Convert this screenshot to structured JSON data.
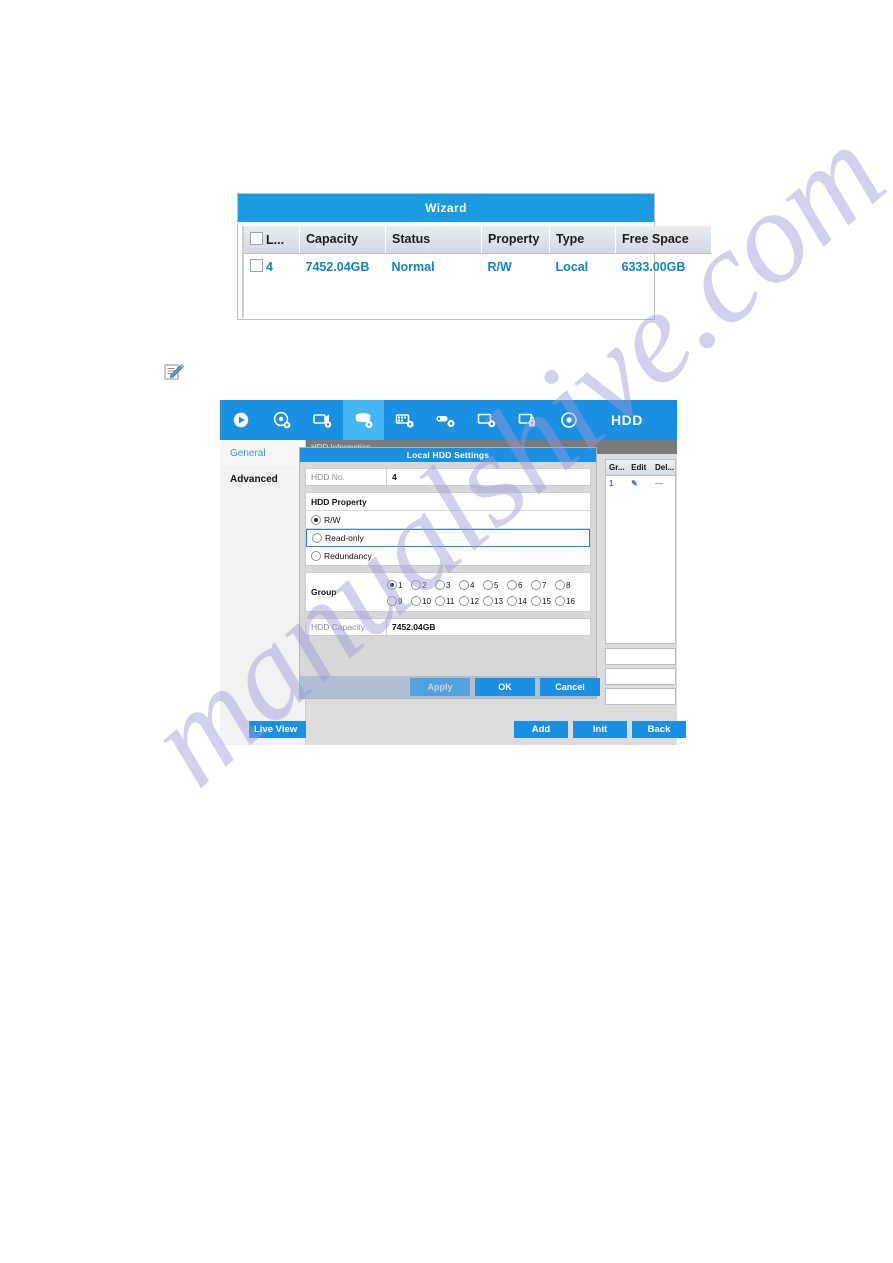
{
  "watermark": {
    "text": "manualshive.com"
  },
  "figure1": {
    "title": "Wizard",
    "table": {
      "columns": [
        "L...",
        "Capacity",
        "Status",
        "Property",
        "Type",
        "Free Space"
      ],
      "rows": [
        {
          "label": "4",
          "capacity": "7452.04GB",
          "status": "Normal",
          "property": "R/W",
          "type": "Local",
          "free_space": "6333.00GB"
        }
      ]
    }
  },
  "note_icon": {
    "name": "note-pencil-icon"
  },
  "figure2": {
    "navbar": {
      "title": "HDD",
      "icons": [
        {
          "name": "playback-icon",
          "active": false
        },
        {
          "name": "export-icon",
          "active": false
        },
        {
          "name": "camera-settings-icon",
          "active": false
        },
        {
          "name": "hdd-settings-icon",
          "active": true
        },
        {
          "name": "record-settings-icon",
          "active": false
        },
        {
          "name": "alarm-settings-icon",
          "active": false
        },
        {
          "name": "network-settings-icon",
          "active": false
        },
        {
          "name": "system-settings-icon",
          "active": false
        },
        {
          "name": "maintenance-icon",
          "active": false
        }
      ]
    },
    "left_menu": {
      "items": [
        {
          "label": "General",
          "selected": true
        },
        {
          "label": "Advanced",
          "selected": false
        }
      ],
      "live_view_label": "Live View"
    },
    "content": {
      "header_label": "HDD Information",
      "mini_table": {
        "columns": [
          "Gr...",
          "Edit",
          "Del..."
        ],
        "rows": [
          {
            "group": "1",
            "edit": "✎",
            "delete": "—"
          }
        ]
      }
    },
    "main_buttons": [
      {
        "label": "Add",
        "name": "add-button"
      },
      {
        "label": "Init",
        "name": "init-button"
      },
      {
        "label": "Back",
        "name": "back-button"
      }
    ],
    "dialog": {
      "title": "Local HDD Settings",
      "hdd_no": {
        "label": "HDD No.",
        "value": "4"
      },
      "hdd_property": {
        "header": "HDD Property",
        "options": [
          {
            "label": "R/W",
            "selected": true,
            "focused": false
          },
          {
            "label": "Read-only",
            "selected": false,
            "focused": true
          },
          {
            "label": "Redundancy",
            "selected": false,
            "focused": false
          }
        ]
      },
      "group": {
        "label": "Group",
        "selected": "1",
        "row1": [
          "1",
          "2",
          "3",
          "4",
          "5",
          "6",
          "7",
          "8"
        ],
        "row2": [
          "9",
          "10",
          "11",
          "12",
          "13",
          "14",
          "15",
          "16"
        ]
      },
      "hdd_capacity": {
        "label": "HDD Capacity",
        "value": "7452.04GB"
      },
      "buttons": [
        {
          "label": "Apply",
          "name": "apply-button",
          "disabled": true
        },
        {
          "label": "OK",
          "name": "ok-button",
          "disabled": false
        },
        {
          "label": "Cancel",
          "name": "cancel-button",
          "disabled": false
        }
      ]
    }
  },
  "colors": {
    "accent_blue": "#1a90e2",
    "title_blue": "#1a9ae0",
    "value_blue": "#1183c9",
    "focus_blue": "#2a86d8",
    "panel_gray": "#dcdcdc",
    "watermark_purple": "#9a9ad8"
  }
}
